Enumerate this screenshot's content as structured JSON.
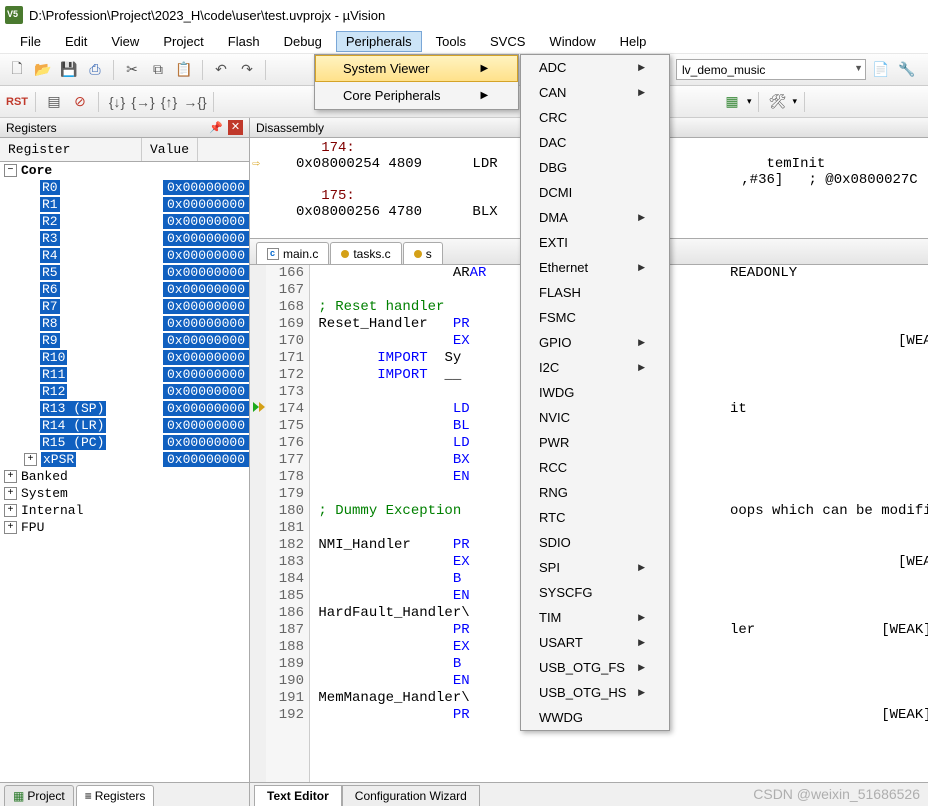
{
  "title": "D:\\Profession\\Project\\2023_H\\code\\user\\test.uvprojx - µVision",
  "menubar": [
    "File",
    "Edit",
    "View",
    "Project",
    "Flash",
    "Debug",
    "Peripherals",
    "Tools",
    "SVCS",
    "Window",
    "Help"
  ],
  "menubar_open_index": 6,
  "peripherals_menu": {
    "items": [
      {
        "label": "System Viewer",
        "highlighted": true,
        "submenu": true
      },
      {
        "label": "Core Peripherals",
        "submenu": true
      }
    ]
  },
  "system_viewer_submenu": [
    {
      "label": "ADC",
      "sub": true
    },
    {
      "label": "CAN",
      "sub": true
    },
    {
      "label": "CRC"
    },
    {
      "label": "DAC"
    },
    {
      "label": "DBG"
    },
    {
      "label": "DCMI"
    },
    {
      "label": "DMA",
      "sub": true
    },
    {
      "label": "EXTI"
    },
    {
      "label": "Ethernet",
      "sub": true
    },
    {
      "label": "FLASH"
    },
    {
      "label": "FSMC"
    },
    {
      "label": "GPIO",
      "sub": true
    },
    {
      "label": "I2C",
      "sub": true
    },
    {
      "label": "IWDG"
    },
    {
      "label": "NVIC"
    },
    {
      "label": "PWR"
    },
    {
      "label": "RCC"
    },
    {
      "label": "RNG"
    },
    {
      "label": "RTC"
    },
    {
      "label": "SDIO"
    },
    {
      "label": "SPI",
      "sub": true
    },
    {
      "label": "SYSCFG"
    },
    {
      "label": "TIM",
      "sub": true
    },
    {
      "label": "USART",
      "sub": true
    },
    {
      "label": "USB_OTG_FS",
      "sub": true
    },
    {
      "label": "USB_OTG_HS",
      "sub": true
    },
    {
      "label": "WWDG"
    }
  ],
  "target_combo": "lv_demo_music",
  "registers_panel": {
    "title": "Registers",
    "cols": [
      "Register",
      "Value"
    ],
    "core_label": "Core",
    "regs": [
      {
        "n": "R0",
        "v": "0x00000000"
      },
      {
        "n": "R1",
        "v": "0x00000000"
      },
      {
        "n": "R2",
        "v": "0x00000000"
      },
      {
        "n": "R3",
        "v": "0x00000000"
      },
      {
        "n": "R4",
        "v": "0x00000000"
      },
      {
        "n": "R5",
        "v": "0x00000000"
      },
      {
        "n": "R6",
        "v": "0x00000000"
      },
      {
        "n": "R7",
        "v": "0x00000000"
      },
      {
        "n": "R8",
        "v": "0x00000000"
      },
      {
        "n": "R9",
        "v": "0x00000000"
      },
      {
        "n": "R10",
        "v": "0x00000000"
      },
      {
        "n": "R11",
        "v": "0x00000000"
      },
      {
        "n": "R12",
        "v": "0x00000000"
      },
      {
        "n": "R13 (SP)",
        "v": "0x00000000"
      },
      {
        "n": "R14 (LR)",
        "v": "0x00000000"
      },
      {
        "n": "R15 (PC)",
        "v": "0x00000000"
      },
      {
        "n": "xPSR",
        "v": "0x00000000"
      }
    ],
    "extra": [
      "Banked",
      "System",
      "Internal",
      "FPU"
    ]
  },
  "bottom_tabs": [
    "Project",
    "Registers"
  ],
  "disassembly": {
    "title": "Disassembly",
    "lines": [
      {
        "n": "174:",
        "cur": false
      },
      {
        "addr": "0x08000254",
        "hex": "4809",
        "op": "LDR",
        "rest": "temInit",
        "cur": true
      },
      {
        "rest2": ",#36]   ; @0x0800027C"
      },
      {
        "n": "175:"
      },
      {
        "addr": "0x08000256",
        "hex": "4780",
        "op": "BLX",
        "rest": ""
      }
    ]
  },
  "file_tabs": [
    "main.c",
    "tasks.c",
    "s"
  ],
  "editor": {
    "start": 166,
    "lines": [
      {
        "t": "                AR",
        "k": "AR",
        "post": "",
        "cls": "kw",
        "right": "READONLY"
      },
      {
        "t": ""
      },
      {
        "t": "; Reset handler",
        "cls": "cmt"
      },
      {
        "t": "Reset_Handler   ",
        "k": "PR",
        "right": ""
      },
      {
        "t": "                ",
        "k": "EX",
        "right": "                    [WEAK]"
      },
      {
        "t": "        IMPORT  Sy",
        "k": "IMPORT"
      },
      {
        "t": "        IMPORT  __",
        "k": "IMPORT"
      },
      {
        "t": ""
      },
      {
        "t": "                ",
        "k": "LD",
        "right": "it",
        "mark": true
      },
      {
        "t": "                ",
        "k": "BL"
      },
      {
        "t": "                ",
        "k": "LD"
      },
      {
        "t": "                ",
        "k": "BX"
      },
      {
        "t": "                ",
        "k": "EN"
      },
      {
        "t": ""
      },
      {
        "t": "; Dummy Exception ",
        "cls": "cmt",
        "right": "oops which can be modified)"
      },
      {
        "t": ""
      },
      {
        "t": "NMI_Handler     ",
        "k": "PR"
      },
      {
        "t": "                ",
        "k": "EX",
        "right": "                    [WEAK]"
      },
      {
        "t": "                ",
        "k": "B"
      },
      {
        "t": "                ",
        "k": "EN"
      },
      {
        "t": "HardFault_Handler\\"
      },
      {
        "t": "                ",
        "k": "PR",
        "right": "ler               [WEAK]"
      },
      {
        "t": "                ",
        "k": "EX"
      },
      {
        "t": "                ",
        "k": "B"
      },
      {
        "t": "                ",
        "k": "EN"
      },
      {
        "t": "MemManage_Handler\\"
      },
      {
        "t": "                ",
        "k": "PR",
        "right": "                  [WEAK]"
      }
    ]
  },
  "editor_tabs": [
    "Text Editor",
    "Configuration Wizard"
  ],
  "watermark": "CSDN @weixin_51686526"
}
